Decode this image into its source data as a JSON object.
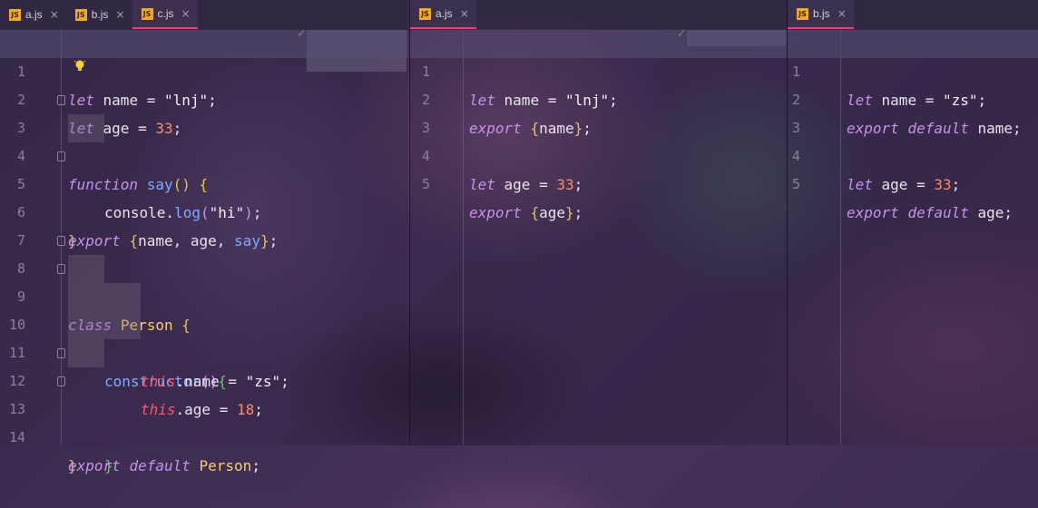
{
  "colors": {
    "tab_accent": "#e0457b",
    "keyword": "#c792ea",
    "number": "#f78c6c",
    "function": "#82aaff",
    "class": "#ffcb6b",
    "this": "#ff5370",
    "icon_js": "#f0a832"
  },
  "pane1": {
    "tabs": [
      {
        "label": "a.js",
        "icon": "js-icon"
      },
      {
        "label": "b.js",
        "icon": "js-icon"
      },
      {
        "label": "c.js",
        "icon": "js-icon",
        "active": true
      }
    ],
    "lines": [
      "1",
      "2",
      "3",
      "4",
      "5",
      "6",
      "7",
      "8",
      "9",
      "10",
      "11",
      "12",
      "13",
      "14"
    ],
    "code": {
      "l1": {
        "kw": "let",
        "rest": " name = ",
        "str": "\"lnj\"",
        "end": ";"
      },
      "l2": {
        "kw": "let",
        "rest": " age = ",
        "num": "33",
        "end": ";"
      },
      "l3": {
        "kw": "function",
        "fn": "say",
        "p": "()",
        "sp": " ",
        "b": "{"
      },
      "l4": {
        "obj": "console.",
        "fn": "log",
        "p1": "(",
        "str": "\"hi\"",
        "p2": ")",
        "end": ";"
      },
      "l5": {
        "b": "}"
      },
      "l6": {
        "kw": "export",
        "sp": " ",
        "b1": "{",
        "items": "name, age, ",
        "fn": "say",
        "b2": "}",
        "end": ";"
      },
      "l8": {
        "kw": "class",
        "sp": " ",
        "cls": "Person",
        "sp2": " ",
        "b": "{"
      },
      "l9": {
        "fn": "constructor",
        "p": "()",
        "b": "{"
      },
      "l10": {
        "this": "this",
        "rest": ".name = ",
        "str": "\"zs\"",
        "end": ";"
      },
      "l11": {
        "this": "this",
        "rest": ".age = ",
        "num": "18",
        "end": ";"
      },
      "l12": {
        "b": "}"
      },
      "l13": {
        "b": "}"
      },
      "l14": {
        "kw1": "export",
        "sp": " ",
        "kw2": "default",
        "sp2": " ",
        "cls": "Person",
        "end": ";"
      }
    }
  },
  "pane2": {
    "tabs": [
      {
        "label": "a.js",
        "icon": "js-icon",
        "active": true
      }
    ],
    "lines": [
      "1",
      "2",
      "3",
      "4",
      "5"
    ],
    "code": {
      "l1": {
        "kw": "let",
        "rest": " name = ",
        "str": "\"lnj\"",
        "end": ";"
      },
      "l2": {
        "kw": "export",
        "sp": " ",
        "b1": "{",
        "items": "name",
        "b2": "}",
        "end": ";"
      },
      "l4": {
        "kw": "let",
        "rest": " age = ",
        "num": "33",
        "end": ";"
      },
      "l5": {
        "kw": "export",
        "sp": " ",
        "b1": "{",
        "items": "age",
        "b2": "}",
        "end": ";"
      }
    }
  },
  "pane3": {
    "tabs": [
      {
        "label": "b.js",
        "icon": "js-icon",
        "active": true
      }
    ],
    "lines": [
      "1",
      "2",
      "3",
      "4",
      "5"
    ],
    "code": {
      "l1": {
        "kw": "let",
        "rest": " name = ",
        "str": "\"zs\"",
        "end": ";"
      },
      "l2": {
        "kw1": "export",
        "sp": " ",
        "kw2": "default",
        "rest": " name",
        "end": ";"
      },
      "l4": {
        "kw": "let",
        "rest": " age = ",
        "num": "33",
        "end": ";"
      },
      "l5": {
        "kw1": "export",
        "sp": " ",
        "kw2": "default",
        "rest": " age",
        "end": ";"
      }
    }
  },
  "close_glyph": "×",
  "js_glyph": "JS",
  "check_glyph": "✓"
}
